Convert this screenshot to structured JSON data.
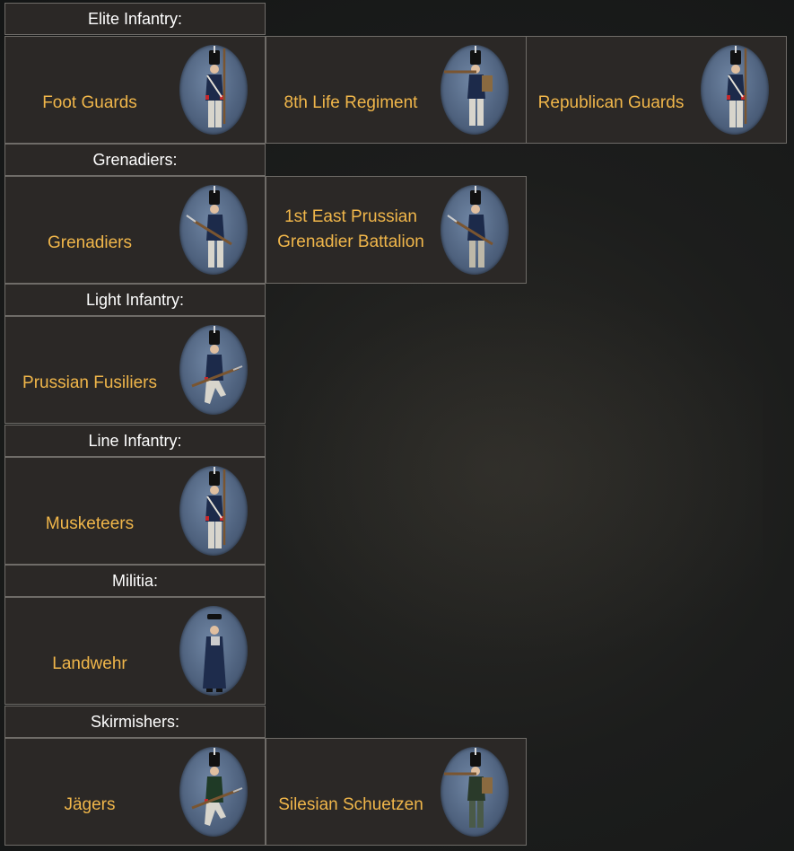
{
  "sections": [
    {
      "header": "Elite Infantry:",
      "units": [
        {
          "name": "Foot Guards",
          "pose": "standing",
          "uniform": "#1c2a4a",
          "trousers": "#d8d5cc"
        },
        {
          "name": "8th Life Regiment",
          "pose": "aiming",
          "uniform": "#1c2a4a",
          "trousers": "#d8d5cc"
        },
        {
          "name": "Republican Guards",
          "pose": "standing",
          "uniform": "#1c2a4a",
          "trousers": "#d8d5cc"
        }
      ]
    },
    {
      "header": "Grenadiers:",
      "units": [
        {
          "name": "Grenadiers",
          "pose": "port-arms",
          "uniform": "#1c2a4a",
          "trousers": "#d8d5cc"
        },
        {
          "name": "1st East Prussian\nGrenadier Battalion",
          "pose": "charge",
          "uniform": "#1c2a4a",
          "trousers": "#bdb8a8"
        }
      ]
    },
    {
      "header": "Light Infantry:",
      "units": [
        {
          "name": "Prussian Fusiliers",
          "pose": "kneeling",
          "uniform": "#1c2a4a",
          "trousers": "#d8d5cc"
        }
      ]
    },
    {
      "header": "Line Infantry:",
      "units": [
        {
          "name": "Musketeers",
          "pose": "standing",
          "uniform": "#1c2a4a",
          "trousers": "#d8d5cc"
        }
      ]
    },
    {
      "header": "Militia:",
      "units": [
        {
          "name": "Landwehr",
          "pose": "coat",
          "uniform": "#1e2c4c",
          "trousers": "#1e2c4c"
        }
      ]
    },
    {
      "header": "Skirmishers:",
      "units": [
        {
          "name": "Jägers",
          "pose": "kneeling",
          "uniform": "#1f3a26",
          "trousers": "#d8d5cc"
        },
        {
          "name": "Silesian Schuetzen",
          "pose": "aiming",
          "uniform": "#2a3a2a",
          "trousers": "#4a5a48"
        }
      ]
    }
  ],
  "colors": {
    "unit_name": "#f0b64a",
    "header_text": "#ffffff",
    "cell_bg": "#2b2826",
    "cell_border": "#6f6c68",
    "cuff_red": "#c8262a"
  }
}
